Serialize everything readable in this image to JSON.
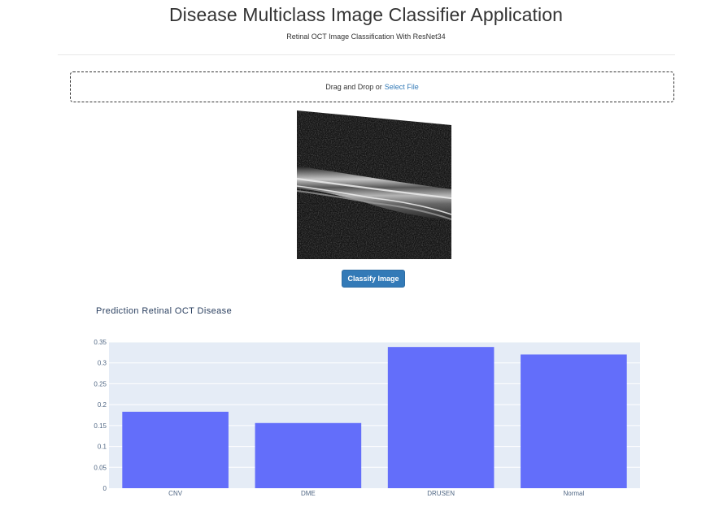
{
  "header": {
    "title": "Disease Multiclass Image Classifier Application",
    "subtitle": "Retinal OCT Image Classification With ResNet34"
  },
  "upload": {
    "prompt": "Drag and Drop or",
    "link_label": "Select File"
  },
  "image": {
    "description": "retinal-oct-scan"
  },
  "actions": {
    "classify_label": "Classify Image"
  },
  "colors": {
    "accent": "#337ab7",
    "bar": "#636efa",
    "plot_bg": "#e5ecf6",
    "title_text": "#2a3f5f"
  },
  "chart_data": {
    "type": "bar",
    "title": "Prediction Retinal OCT Disease",
    "categories": [
      "CNV",
      "DME",
      "DRUSEN",
      "Normal"
    ],
    "values": [
      0.183,
      0.156,
      0.338,
      0.32
    ],
    "ylim": [
      0,
      0.35
    ],
    "yticks": [
      0,
      0.05,
      0.1,
      0.15,
      0.2,
      0.25,
      0.3,
      0.35
    ],
    "ytick_labels": [
      "0",
      "0.05",
      "0.1",
      "0.15",
      "0.2",
      "0.25",
      "0.3",
      "0.35"
    ],
    "grid": true,
    "legend": "none"
  }
}
